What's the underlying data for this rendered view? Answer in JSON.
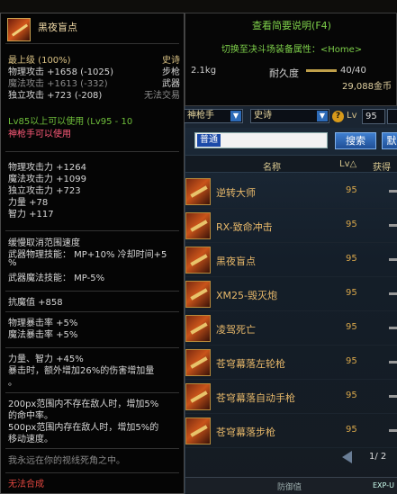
{
  "tooltip": {
    "item_name": "黑夜盲点",
    "header_lines": [
      {
        "left": "最上级 (100%)",
        "right": "史诗",
        "cls": "yel",
        "rcls": "yel"
      },
      {
        "left": "物理攻击 +1658 (-1025)",
        "right": "步枪",
        "cls": "white",
        "rcls": "white"
      },
      {
        "left": "魔法攻击 +1613 (-332)",
        "right": "武器",
        "cls": "gray",
        "rcls": "white"
      },
      {
        "left": "独立攻击 +723 (-208)",
        "right": "无法交易",
        "cls": "white",
        "rcls": "gray"
      }
    ],
    "level_req": "Lv85以上可以使用 (Lv95 - 10",
    "class_req": "神枪手可以使用",
    "stats": [
      "物理攻击力 +1264",
      "魔法攻击力 +1099",
      "独立攻击力 +723",
      "力量 +78",
      "智力 +117"
    ],
    "skill_lines": [
      "缓慢取消范围速度",
      "武器物理技能： MP+10% 冷却时间+5",
      "%",
      "武器魔法技能： MP-5%"
    ],
    "anti_magic": "抗魔值 +858",
    "crit_lines": [
      "物理暴击率 +5%",
      "魔法暴击率 +5%"
    ],
    "bonus_lines": [
      "力量、智力 +45%",
      "暴击时，额外增加26%的伤害增加量",
      "。"
    ],
    "aura_lines": [
      "200px范围内不存在敌人时，增加5%",
      "的命中率。",
      "500px范围内存在敌人时，增加5%的",
      "移动速度。"
    ],
    "flavor": "我永远在你的视线死角之中。",
    "cannot_combine": "无法合成"
  },
  "compare": {
    "view_summary": "查看简要说明(F4)",
    "switch_pvp": "切换至决斗场装备属性：<Home>",
    "weight": "2.1kg",
    "durability_label": "耐久度",
    "durability_value": "40/40",
    "durability_fraction": 1.0,
    "price": "29,088金币"
  },
  "auction": {
    "class_filter": "神枪手",
    "rarity_filter": "史诗",
    "lv_label": "Lv",
    "lv_value": "95",
    "search_text": "普通",
    "search_button": "搜索",
    "buy_button": "默",
    "columns": {
      "name": "名称",
      "lv": "Lv△",
      "obtain": "获得"
    },
    "items": [
      {
        "name": "逆转大师",
        "lv": "95"
      },
      {
        "name": "RX-致命冲击",
        "lv": "95"
      },
      {
        "name": "黑夜盲点",
        "lv": "95"
      },
      {
        "name": "XM25-毁灭炮",
        "lv": "95"
      },
      {
        "name": "凌驾死亡",
        "lv": "95"
      },
      {
        "name": "苍穹幕落左轮枪",
        "lv": "95"
      },
      {
        "name": "苍穹幕落自动手枪",
        "lv": "95"
      },
      {
        "name": "苍穹幕落步枪",
        "lv": "95"
      }
    ],
    "page": "1/ 2",
    "bottom_left": "防御值",
    "bottom_right": "EXP-U"
  }
}
